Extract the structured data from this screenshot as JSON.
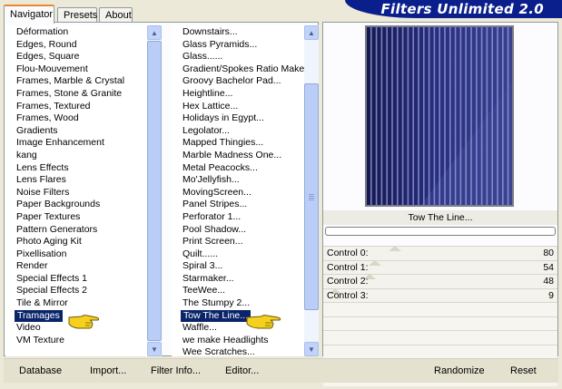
{
  "tabs": [
    "Navigator",
    "Presets",
    "About"
  ],
  "app_title": "Filters Unlimited 2.0",
  "categories": [
    "Déformation",
    "Edges, Round",
    "Edges, Square",
    "Flou-Mouvement",
    "Frames, Marble & Crystal",
    "Frames, Stone & Granite",
    "Frames, Textured",
    "Frames, Wood",
    "Gradients",
    "Image Enhancement",
    "kang",
    "Lens Effects",
    "Lens Flares",
    "Noise Filters",
    "Paper Backgrounds",
    "Paper Textures",
    "Pattern Generators",
    "Photo Aging Kit",
    "Pixellisation",
    "Render",
    "Special Effects 1",
    "Special Effects 2",
    "Tile & Mirror",
    "Tramages",
    "Video",
    "VM Texture"
  ],
  "selected_category": "Tramages",
  "filters": [
    "Downstairs...",
    "Glass Pyramids...",
    "Glass......",
    "Gradient/Spokes Ratio Maker...",
    "Groovy Bachelor Pad...",
    "Heightline...",
    "Hex Lattice...",
    "Holidays in Egypt...",
    "Legolator...",
    "Mapped Thingies...",
    "Marble Madness One...",
    "Metal Peacocks...",
    "Mo'Jellyfish...",
    "MovingScreen...",
    "Panel Stripes...",
    "Perforator 1...",
    "Pool Shadow...",
    "Print Screen...",
    "Quilt......",
    "Spiral 3...",
    "Starmaker...",
    "TeeWee...",
    "The Stumpy 2...",
    "Tow The Line...",
    "Waffle...",
    "we make Headlights",
    "Wee Scratches..."
  ],
  "selected_filter": "Tow The Line...",
  "preview_filter_name": "Tow The Line...",
  "controls": [
    {
      "label": "Control 0:",
      "value": "80"
    },
    {
      "label": "Control 1:",
      "value": "54"
    },
    {
      "label": "Control 2:",
      "value": "48"
    },
    {
      "label": "Control 3:",
      "value": "9"
    }
  ],
  "buttons": {
    "database": "Database",
    "import": "Import...",
    "filter_info": "Filter Info...",
    "editor": "Editor...",
    "randomize": "Randomize",
    "reset": "Reset"
  },
  "colors": {
    "accent_tab": "#e68b2c",
    "title_bg": "#0a1e8c",
    "selection": "#0a246a",
    "preview_bg": "#1e2062",
    "hand": "#f5d01c"
  },
  "icons": {
    "pointer": "pointing-hand-icon",
    "scroll_up": "scroll-up-arrow-icon",
    "scroll_down": "scroll-down-arrow-icon"
  }
}
